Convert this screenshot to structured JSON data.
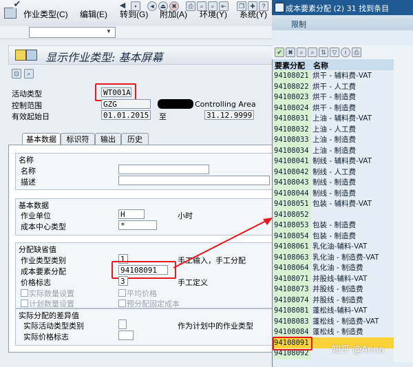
{
  "menu": {
    "items": [
      "作业类型(C)",
      "编辑(E)",
      "转到(G)",
      "附加(A)",
      "环境(Y)",
      "系统(Y)"
    ]
  },
  "screen": {
    "title": "显示作业类型:  基本屏幕",
    "activity_type_label": "活动类型",
    "activity_type_value": "WT001A",
    "controlling_area_label": "控制范围",
    "controlling_area_value": "GZG",
    "controlling_area_text": "Controlling Area",
    "valid_from_label": "有效起始日",
    "valid_from_value": "01.01.2015",
    "to_label": "至",
    "valid_to_value": "31.12.9999"
  },
  "tabs": [
    "基本数据",
    "标识符",
    "输出",
    "历史"
  ],
  "names_group": {
    "title": "名称",
    "name_label": "名称",
    "desc_label": "描述"
  },
  "basic_group": {
    "title": "基本数据",
    "unit_label": "作业单位",
    "unit_value": "H",
    "unit_text": "小时",
    "cc_type_label": "成本中心类型",
    "cc_type_value": "*"
  },
  "alloc_group": {
    "title": "分配缺省值",
    "act_cat_label": "作业类型类别",
    "act_cat_value": "1",
    "act_cat_text": "手工输入，手工分配",
    "cost_elem_label": "成本要素分配",
    "cost_elem_value": "94108091",
    "price_label": "价格标志",
    "price_value": "3",
    "price_text": "手工定义",
    "chk_actual_qty": "实际数量设置",
    "chk_avg_price": "平均价格",
    "chk_plan_qty": "计划数量设置",
    "chk_pre_fixed": "预分配固定成本"
  },
  "variance_group": {
    "title": "实际分配的差异值",
    "actual_cat_label": "实际活动类型类别",
    "actual_cat_text": "作为计划中的作业类型",
    "actual_price_label": "实际价格标志"
  },
  "popup": {
    "title": "成本要素分配 (2)   31 找到条目",
    "tab_label": "限制",
    "col_key": "要素分配",
    "col_name": "名称",
    "rows": [
      {
        "key": "94108021",
        "name": "烘干 - 辅料费-VAT"
      },
      {
        "key": "94108022",
        "name": "烘干 - 人工费"
      },
      {
        "key": "94108023",
        "name": "烘干 - 制造费"
      },
      {
        "key": "94108024",
        "name": "烘干 - 制造费"
      },
      {
        "key": "94108031",
        "name": "上油 - 辅料费-VAT"
      },
      {
        "key": "94108032",
        "name": "上油 - 人工费"
      },
      {
        "key": "94108033",
        "name": "上油 - 制造费"
      },
      {
        "key": "94108034",
        "name": "上油 - 制造费"
      },
      {
        "key": "94108041",
        "name": "制线 - 辅料费-VAT"
      },
      {
        "key": "94108042",
        "name": "制线 - 人工费"
      },
      {
        "key": "94108043",
        "name": "制线 - 制造费"
      },
      {
        "key": "94108044",
        "name": "制线 - 制造费"
      },
      {
        "key": "94108051",
        "name": "包装 - 辅料费-VAT"
      },
      {
        "key": "94108052",
        "name": ""
      },
      {
        "key": "94108053",
        "name": "包装 - 制造费"
      },
      {
        "key": "94108054",
        "name": "包装 - 制造费"
      },
      {
        "key": "94108061",
        "name": "乳化油-辅料-VAT"
      },
      {
        "key": "94108063",
        "name": "乳化油 - 制造费-VAT"
      },
      {
        "key": "94108064",
        "name": "乳化油 - 制造费"
      },
      {
        "key": "94108071",
        "name": "并股线-辅料-VAT"
      },
      {
        "key": "94108073",
        "name": "并股线 - 制造费"
      },
      {
        "key": "94108074",
        "name": "并股线 - 制造费"
      },
      {
        "key": "94108081",
        "name": "蓬松线-辅料-VAT"
      },
      {
        "key": "94108083",
        "name": "蓬松线 - 制造费-VAT"
      },
      {
        "key": "94108084",
        "name": "蓬松线 - 制造费"
      },
      {
        "key": "94108091",
        "name": ""
      },
      {
        "key": "94108092",
        "name": ""
      }
    ],
    "highlight_color": "#fbd23a",
    "watermark": "知乎 @Anna"
  },
  "colors": {
    "annotation_red": "#e8171d",
    "popup_title_bg": "#1f5a93",
    "key_column_bg": "#d9f0d3"
  }
}
